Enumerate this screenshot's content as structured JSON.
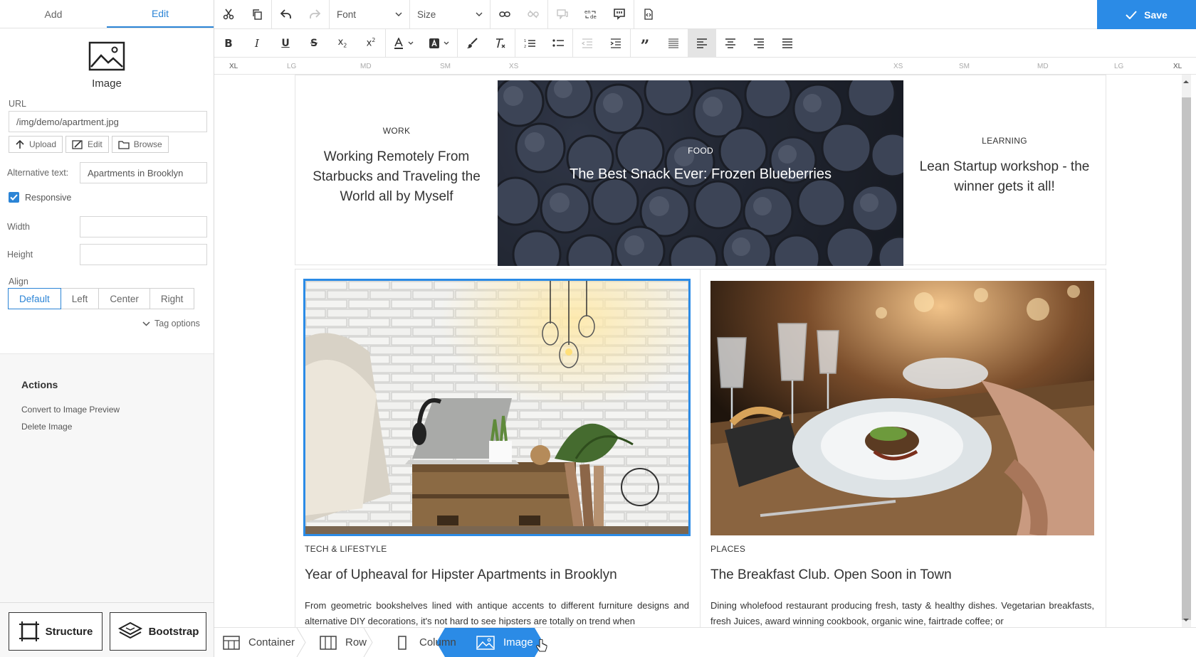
{
  "left_panel": {
    "tabs": [
      {
        "label": "Add"
      },
      {
        "label": "Edit"
      }
    ],
    "element_title": "Image",
    "url_label": "URL",
    "url_value": "/img/demo/apartment.jpg",
    "upload_label": "Upload",
    "edit_label": "Edit",
    "browse_label": "Browse",
    "alt_label": "Alternative text:",
    "alt_value": "Apartments in Brooklyn",
    "responsive_label": "Responsive",
    "width_label": "Width",
    "height_label": "Height",
    "align_label": "Align",
    "align_options": [
      "Default",
      "Left",
      "Center",
      "Right"
    ],
    "tag_options_label": "Tag options",
    "actions_title": "Actions",
    "actions": [
      "Convert to Image Preview",
      "Delete Image"
    ],
    "structure_label": "Structure",
    "bootstrap_label": "Bootstrap"
  },
  "toolbar": {
    "font_label": "Font",
    "size_label": "Size",
    "save_label": "Save"
  },
  "ruler": {
    "left": [
      "XL",
      "LG",
      "MD",
      "SM",
      "XS"
    ],
    "right": [
      "XS",
      "SM",
      "MD",
      "LG",
      "XL"
    ]
  },
  "content": {
    "top_cards": [
      {
        "category": "WORK",
        "title": "Working Remotely From Starbucks and Traveling the World all by Myself"
      },
      {
        "category": "FOOD",
        "title": "The Best Snack Ever: Frozen Blueberries"
      },
      {
        "category": "LEARNING",
        "title": "Lean Startup workshop - the winner gets it all!"
      }
    ],
    "bottom_cards": [
      {
        "category": "TECH & LIFESTYLE",
        "title": "Year of Upheaval for Hipster Apartments in Brooklyn",
        "text": "From geometric bookshelves lined with antique accents to different furniture designs and alternative DIY decorations, it's not hard to see hipsters are totally on trend when"
      },
      {
        "category": "PLACES",
        "title": "The Breakfast Club. Open Soon in Town",
        "text": "Dining wholefood restaurant producing fresh, tasty & healthy dishes. Vegetarian breakfasts, fresh Juices, award winning cookbook, organic wine, fairtrade coffee; or"
      }
    ]
  },
  "breadcrumb": [
    "Container",
    "Row",
    "Column",
    "Image"
  ],
  "colors": {
    "accent": "#2b8be6",
    "active_tab": "#2b84d6"
  }
}
